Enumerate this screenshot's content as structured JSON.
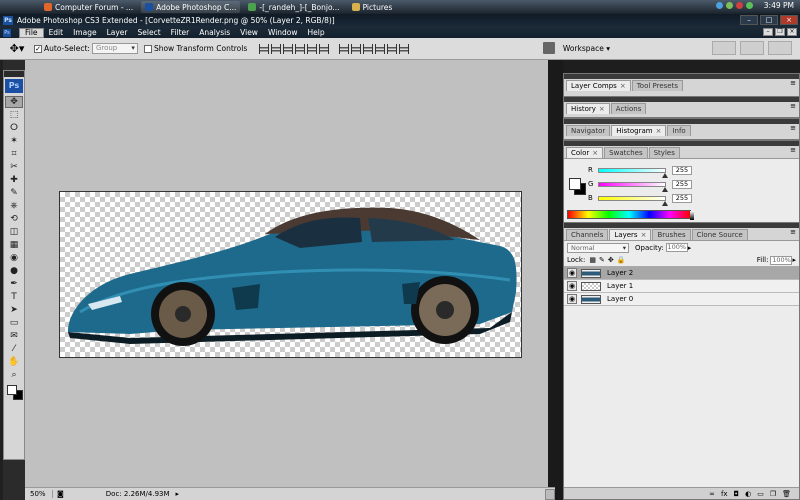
{
  "taskbar": {
    "items": [
      {
        "label": "Computer Forum - ...",
        "color": "#e0662a"
      },
      {
        "label": "Adobe Photoshop C...",
        "color": "#1b4fa0"
      },
      {
        "label": "-[_randeh_]-[_Bonjo...",
        "color": "#4ca24c"
      },
      {
        "label": "Pictures",
        "color": "#d9b04a"
      }
    ],
    "clock": "3:49 PM"
  },
  "window": {
    "title": "Adobe Photoshop CS3 Extended - [CorvetteZR1Render.png @ 50% (Layer 2, RGB/8)]",
    "app_badge": "Ps",
    "controls": [
      "–",
      "□",
      "×"
    ]
  },
  "menubar": {
    "items": [
      "File",
      "Edit",
      "Image",
      "Layer",
      "Select",
      "Filter",
      "Analysis",
      "View",
      "Window",
      "Help"
    ]
  },
  "options": {
    "auto_select_label": "Auto-Select:",
    "auto_select_value": "Group",
    "show_transform_label": "Show Transform Controls",
    "workspace_label": "Workspace ▾"
  },
  "toolbox": {
    "logo": "Ps",
    "tools": [
      "move-tool",
      "marquee-tool",
      "lasso-tool",
      "magic-wand-tool",
      "crop-tool",
      "slice-tool",
      "healing-brush-tool",
      "brush-tool",
      "clone-stamp-tool",
      "history-brush-tool",
      "eraser-tool",
      "gradient-tool",
      "blur-tool",
      "dodge-tool",
      "pen-tool",
      "type-tool",
      "path-selection-tool",
      "shape-tool",
      "notes-tool",
      "eyedropper-tool",
      "hand-tool",
      "zoom-tool"
    ],
    "glyphs": [
      "✥",
      "⬚",
      "ⵔ",
      "✶",
      "⌗",
      "✂",
      "✚",
      "✎",
      "⎈",
      "⟲",
      "◫",
      "▦",
      "◉",
      "●",
      "✒",
      "T",
      "➤",
      "▭",
      "✉",
      "⁄",
      "✋",
      "⌕"
    ]
  },
  "status": {
    "zoom": "50%",
    "doc": "Doc: 2.26M/4.93M"
  },
  "panels": {
    "group1_tabs": [
      "Layer Comps",
      "Tool Presets"
    ],
    "group2_tabs": [
      "History",
      "Actions"
    ],
    "group3_tabs": [
      "Navigator",
      "Histogram",
      "Info"
    ],
    "color_tabs": [
      "Color",
      "Swatches",
      "Styles"
    ],
    "color_channels": [
      {
        "ch": "R",
        "value": "255",
        "gradient": "linear-gradient(90deg,#0ff,#fff)"
      },
      {
        "ch": "G",
        "value": "255",
        "gradient": "linear-gradient(90deg,#f0f,#fff)"
      },
      {
        "ch": "B",
        "value": "255",
        "gradient": "linear-gradient(90deg,#ff0,#fff)"
      }
    ],
    "layers_tabs": [
      "Channels",
      "Layers",
      "Brushes",
      "Clone Source"
    ],
    "blend_mode": "Normal",
    "opacity_label": "Opacity:",
    "opacity_value": "100%",
    "lock_label": "Lock:",
    "fill_label": "Fill:",
    "fill_value": "100%",
    "layers": [
      {
        "name": "Layer 2",
        "selected": true,
        "thumb": "car"
      },
      {
        "name": "Layer 1",
        "selected": false,
        "thumb": "checker"
      },
      {
        "name": "Layer 0",
        "selected": false,
        "thumb": "car"
      }
    ],
    "footer_icons": [
      "∞",
      "fx",
      "◘",
      "◐",
      "▭",
      "❐",
      "🗑"
    ]
  }
}
